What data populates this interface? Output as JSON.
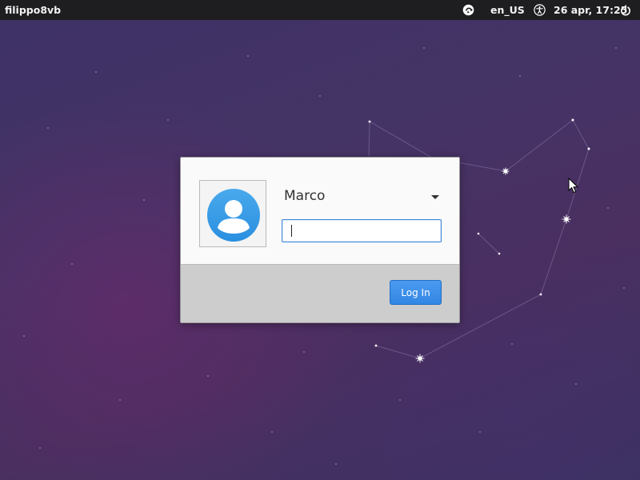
{
  "panel": {
    "hostname": "filippo8vb",
    "keyboard_layout": "en_US",
    "clock": "26 apr, 17:25",
    "session_icon": "session-icon",
    "accessibility_icon": "accessibility-icon",
    "power_icon": "power-icon"
  },
  "login": {
    "username": "Marco",
    "password_value": "",
    "login_button_label": "Log In",
    "avatar_icon": "user-avatar-icon",
    "dropdown_icon": "chevron-down-icon"
  },
  "colors": {
    "panel_background": "#1e1e20",
    "accent": "#3b86d8",
    "button": "#3a8ce8",
    "wallpaper": "#40315f"
  }
}
